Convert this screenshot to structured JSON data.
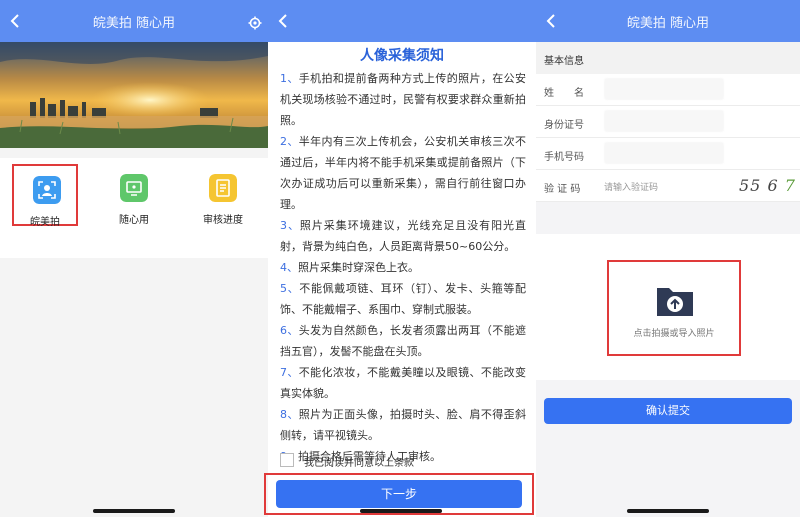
{
  "panel1": {
    "title": "皖美拍 随心用",
    "tiles": [
      {
        "label": "皖美拍"
      },
      {
        "label": "随心用"
      },
      {
        "label": "审核进度"
      }
    ]
  },
  "panel2": {
    "notice_title": "人像采集须知",
    "rules": [
      {
        "num": "1、",
        "text": "手机拍和提前备两种方式上传的照片，在公安机关现场核验不通过时，民警有权要求群众重新拍照。"
      },
      {
        "num": "2、",
        "text": "半年内有三次上传机会，公安机关审核三次不通过后，半年内将不能手机采集或提前备照片（下次办证成功后可以重新采集），需自行前往窗口办理。"
      },
      {
        "num": "3、",
        "text": "照片采集环境建议，光线充足且没有阳光直射，背景为纯白色，人员距离背景50~60公分。"
      },
      {
        "num": "4、",
        "text": "照片采集时穿深色上衣。"
      },
      {
        "num": "5、",
        "text": "不能佩戴项链、耳环（钉）、发卡、头箍等配饰、不能戴帽子、系围巾、穿制式服装。"
      },
      {
        "num": "6、",
        "text": "头发为自然颜色，长发者须露出两耳（不能遮挡五官），发髻不能盘在头顶。"
      },
      {
        "num": "7、",
        "text": "不能化浓妆，不能戴美瞳以及眼镜、不能改变真实体貌。"
      },
      {
        "num": "8、",
        "text": "照片为正面头像，拍摄时头、脸、肩不得歪斜侧转，请平视镜头。"
      },
      {
        "num": "9、",
        "text": "拍摄合格后需等待人工审核。"
      }
    ],
    "agree_text": "我已阅读并同意以上条款",
    "next_button": "下一步"
  },
  "panel3": {
    "title": "皖美拍 随心用",
    "section_header": "基本信息",
    "fields": {
      "name_label": "姓　　名",
      "id_label": "身份证号",
      "phone_label": "手机号码",
      "captcha_label": "验 证 码",
      "captcha_placeholder": "请输入验证码",
      "captcha_text_a": "55 6 ",
      "captcha_text_b": "7"
    },
    "upload_label": "点击拍摄或导入照片",
    "confirm_button": "确认提交"
  },
  "colors": {
    "header_blue": "#5d8df2",
    "button_blue": "#3672f2",
    "highlight_red": "#e03a3a"
  }
}
